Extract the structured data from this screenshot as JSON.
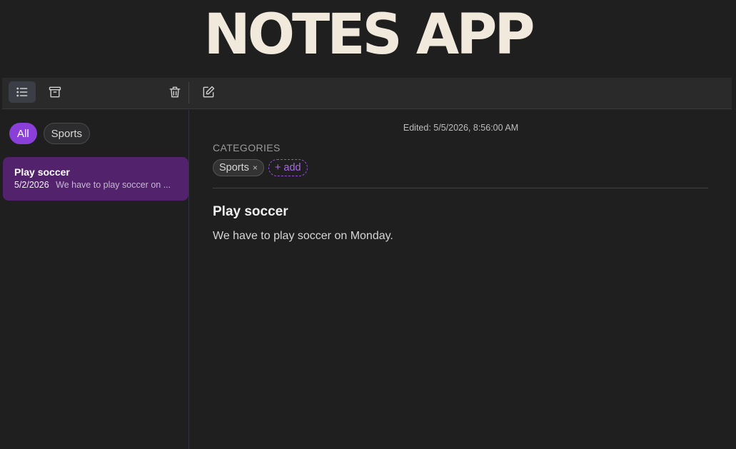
{
  "app": {
    "title": "NOTES APP"
  },
  "toolbar": {
    "list_icon": "list-icon",
    "archive_icon": "archive-icon",
    "trash_icon": "trash-icon",
    "edit_icon": "edit-icon"
  },
  "sidebar": {
    "filters": [
      {
        "label": "All",
        "selected": true
      },
      {
        "label": "Sports",
        "selected": false
      }
    ],
    "notes": [
      {
        "title": "Play soccer",
        "date": "5/2/2026",
        "preview": "We have to play soccer on ..."
      }
    ]
  },
  "editor": {
    "edited": "Edited: 5/5/2026, 8:56:00 AM",
    "categories_label": "CATEGORIES",
    "tags": [
      {
        "label": "Sports",
        "remove": "×"
      }
    ],
    "add_label": "+ add",
    "title": "Play soccer",
    "body": "We have to play soccer on Monday."
  },
  "colors": {
    "accent": "#8a3fd8",
    "selected_note": "#52226c",
    "title": "#f1e9dc"
  }
}
